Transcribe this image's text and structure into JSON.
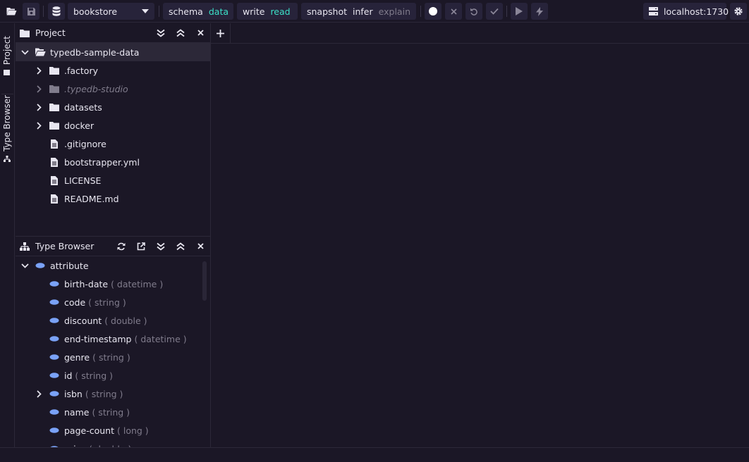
{
  "toolbar": {
    "database": "bookstore",
    "session_schema": "schema",
    "session_data": "data",
    "tx_write": "write",
    "tx_read": "read",
    "opt_snapshot": "snapshot",
    "opt_infer": "infer",
    "opt_explain": "explain",
    "server": "localhost:1730"
  },
  "side_tabs": {
    "project": "Project",
    "type_browser": "Type Browser"
  },
  "project": {
    "title": "Project",
    "root": "typedb-sample-data",
    "items": [
      {
        "label": ".factory"
      },
      {
        "label": ".typedb-studio"
      },
      {
        "label": "datasets"
      },
      {
        "label": "docker"
      },
      {
        "label": ".gitignore"
      },
      {
        "label": "bootstrapper.yml"
      },
      {
        "label": "LICENSE"
      },
      {
        "label": "README.md"
      }
    ]
  },
  "type_browser": {
    "title": "Type Browser",
    "root": "attribute",
    "items": [
      {
        "name": "birth-date",
        "type": "( datetime )"
      },
      {
        "name": "code",
        "type": "( string )"
      },
      {
        "name": "discount",
        "type": "( double )"
      },
      {
        "name": "end-timestamp",
        "type": "( datetime )"
      },
      {
        "name": "genre",
        "type": "( string )"
      },
      {
        "name": "id",
        "type": "( string )"
      },
      {
        "name": "isbn",
        "type": "( string )"
      },
      {
        "name": "name",
        "type": "( string )"
      },
      {
        "name": "page-count",
        "type": "( long )"
      },
      {
        "name": "price",
        "type": "( double )"
      }
    ]
  },
  "colors": {
    "background": "#1b1726",
    "panel_control": "#27233a",
    "accent": "#3ce0c8",
    "attribute_icon": "#7aa2f7",
    "dim_text": "#807c8c"
  }
}
